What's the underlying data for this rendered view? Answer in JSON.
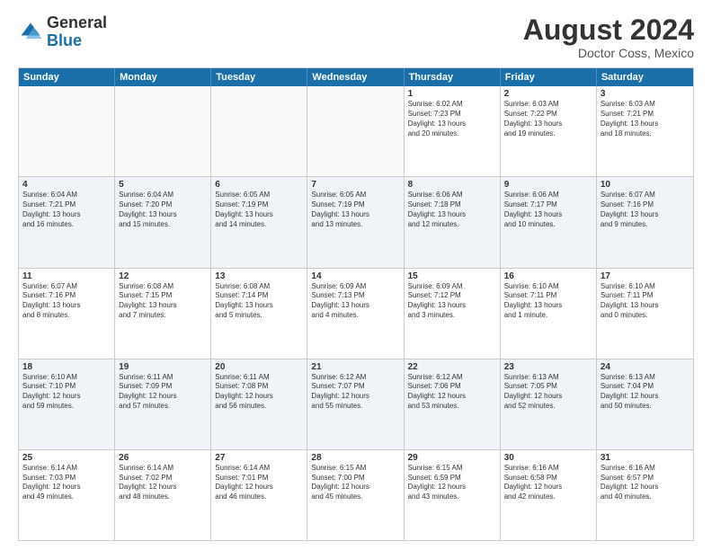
{
  "logo": {
    "general": "General",
    "blue": "Blue"
  },
  "header": {
    "month": "August 2024",
    "location": "Doctor Coss, Mexico"
  },
  "weekdays": [
    "Sunday",
    "Monday",
    "Tuesday",
    "Wednesday",
    "Thursday",
    "Friday",
    "Saturday"
  ],
  "rows": [
    {
      "alt": false,
      "cells": [
        {
          "empty": true,
          "day": "",
          "text": ""
        },
        {
          "empty": true,
          "day": "",
          "text": ""
        },
        {
          "empty": true,
          "day": "",
          "text": ""
        },
        {
          "empty": true,
          "day": "",
          "text": ""
        },
        {
          "empty": false,
          "day": "1",
          "text": "Sunrise: 6:02 AM\nSunset: 7:23 PM\nDaylight: 13 hours\nand 20 minutes."
        },
        {
          "empty": false,
          "day": "2",
          "text": "Sunrise: 6:03 AM\nSunset: 7:22 PM\nDaylight: 13 hours\nand 19 minutes."
        },
        {
          "empty": false,
          "day": "3",
          "text": "Sunrise: 6:03 AM\nSunset: 7:21 PM\nDaylight: 13 hours\nand 18 minutes."
        }
      ]
    },
    {
      "alt": true,
      "cells": [
        {
          "empty": false,
          "day": "4",
          "text": "Sunrise: 6:04 AM\nSunset: 7:21 PM\nDaylight: 13 hours\nand 16 minutes."
        },
        {
          "empty": false,
          "day": "5",
          "text": "Sunrise: 6:04 AM\nSunset: 7:20 PM\nDaylight: 13 hours\nand 15 minutes."
        },
        {
          "empty": false,
          "day": "6",
          "text": "Sunrise: 6:05 AM\nSunset: 7:19 PM\nDaylight: 13 hours\nand 14 minutes."
        },
        {
          "empty": false,
          "day": "7",
          "text": "Sunrise: 6:05 AM\nSunset: 7:19 PM\nDaylight: 13 hours\nand 13 minutes."
        },
        {
          "empty": false,
          "day": "8",
          "text": "Sunrise: 6:06 AM\nSunset: 7:18 PM\nDaylight: 13 hours\nand 12 minutes."
        },
        {
          "empty": false,
          "day": "9",
          "text": "Sunrise: 6:06 AM\nSunset: 7:17 PM\nDaylight: 13 hours\nand 10 minutes."
        },
        {
          "empty": false,
          "day": "10",
          "text": "Sunrise: 6:07 AM\nSunset: 7:16 PM\nDaylight: 13 hours\nand 9 minutes."
        }
      ]
    },
    {
      "alt": false,
      "cells": [
        {
          "empty": false,
          "day": "11",
          "text": "Sunrise: 6:07 AM\nSunset: 7:16 PM\nDaylight: 13 hours\nand 8 minutes."
        },
        {
          "empty": false,
          "day": "12",
          "text": "Sunrise: 6:08 AM\nSunset: 7:15 PM\nDaylight: 13 hours\nand 7 minutes."
        },
        {
          "empty": false,
          "day": "13",
          "text": "Sunrise: 6:08 AM\nSunset: 7:14 PM\nDaylight: 13 hours\nand 5 minutes."
        },
        {
          "empty": false,
          "day": "14",
          "text": "Sunrise: 6:09 AM\nSunset: 7:13 PM\nDaylight: 13 hours\nand 4 minutes."
        },
        {
          "empty": false,
          "day": "15",
          "text": "Sunrise: 6:09 AM\nSunset: 7:12 PM\nDaylight: 13 hours\nand 3 minutes."
        },
        {
          "empty": false,
          "day": "16",
          "text": "Sunrise: 6:10 AM\nSunset: 7:11 PM\nDaylight: 13 hours\nand 1 minute."
        },
        {
          "empty": false,
          "day": "17",
          "text": "Sunrise: 6:10 AM\nSunset: 7:11 PM\nDaylight: 13 hours\nand 0 minutes."
        }
      ]
    },
    {
      "alt": true,
      "cells": [
        {
          "empty": false,
          "day": "18",
          "text": "Sunrise: 6:10 AM\nSunset: 7:10 PM\nDaylight: 12 hours\nand 59 minutes."
        },
        {
          "empty": false,
          "day": "19",
          "text": "Sunrise: 6:11 AM\nSunset: 7:09 PM\nDaylight: 12 hours\nand 57 minutes."
        },
        {
          "empty": false,
          "day": "20",
          "text": "Sunrise: 6:11 AM\nSunset: 7:08 PM\nDaylight: 12 hours\nand 56 minutes."
        },
        {
          "empty": false,
          "day": "21",
          "text": "Sunrise: 6:12 AM\nSunset: 7:07 PM\nDaylight: 12 hours\nand 55 minutes."
        },
        {
          "empty": false,
          "day": "22",
          "text": "Sunrise: 6:12 AM\nSunset: 7:06 PM\nDaylight: 12 hours\nand 53 minutes."
        },
        {
          "empty": false,
          "day": "23",
          "text": "Sunrise: 6:13 AM\nSunset: 7:05 PM\nDaylight: 12 hours\nand 52 minutes."
        },
        {
          "empty": false,
          "day": "24",
          "text": "Sunrise: 6:13 AM\nSunset: 7:04 PM\nDaylight: 12 hours\nand 50 minutes."
        }
      ]
    },
    {
      "alt": false,
      "cells": [
        {
          "empty": false,
          "day": "25",
          "text": "Sunrise: 6:14 AM\nSunset: 7:03 PM\nDaylight: 12 hours\nand 49 minutes."
        },
        {
          "empty": false,
          "day": "26",
          "text": "Sunrise: 6:14 AM\nSunset: 7:02 PM\nDaylight: 12 hours\nand 48 minutes."
        },
        {
          "empty": false,
          "day": "27",
          "text": "Sunrise: 6:14 AM\nSunset: 7:01 PM\nDaylight: 12 hours\nand 46 minutes."
        },
        {
          "empty": false,
          "day": "28",
          "text": "Sunrise: 6:15 AM\nSunset: 7:00 PM\nDaylight: 12 hours\nand 45 minutes."
        },
        {
          "empty": false,
          "day": "29",
          "text": "Sunrise: 6:15 AM\nSunset: 6:59 PM\nDaylight: 12 hours\nand 43 minutes."
        },
        {
          "empty": false,
          "day": "30",
          "text": "Sunrise: 6:16 AM\nSunset: 6:58 PM\nDaylight: 12 hours\nand 42 minutes."
        },
        {
          "empty": false,
          "day": "31",
          "text": "Sunrise: 6:16 AM\nSunset: 6:57 PM\nDaylight: 12 hours\nand 40 minutes."
        }
      ]
    }
  ]
}
